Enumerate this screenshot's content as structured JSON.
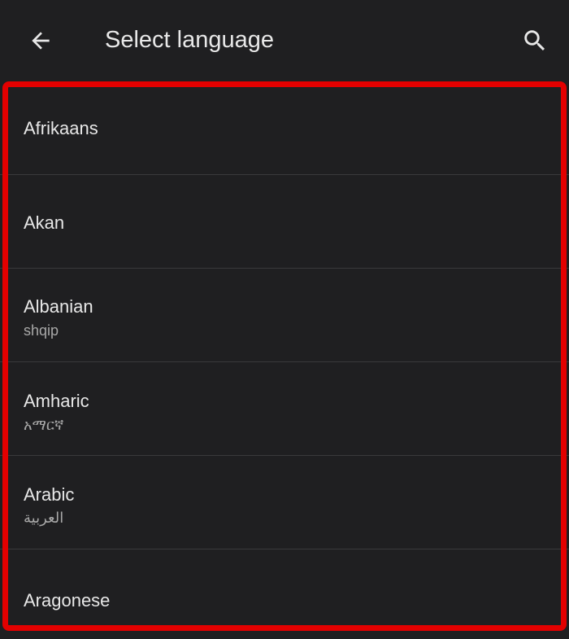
{
  "appbar": {
    "title": "Select language",
    "back_icon": "arrow-back-icon",
    "search_icon": "search-icon"
  },
  "languages": [
    {
      "name": "Afrikaans",
      "native": ""
    },
    {
      "name": "Akan",
      "native": ""
    },
    {
      "name": "Albanian",
      "native": "shqip"
    },
    {
      "name": "Amharic",
      "native": "አማርኛ"
    },
    {
      "name": "Arabic",
      "native": "العربية"
    },
    {
      "name": "Aragonese",
      "native": ""
    }
  ],
  "colors": {
    "background": "#1f1f21",
    "text": "#e8e8e8",
    "subtext": "#a8a8a8",
    "divider": "#3a3a3c",
    "highlight": "#e30000"
  }
}
